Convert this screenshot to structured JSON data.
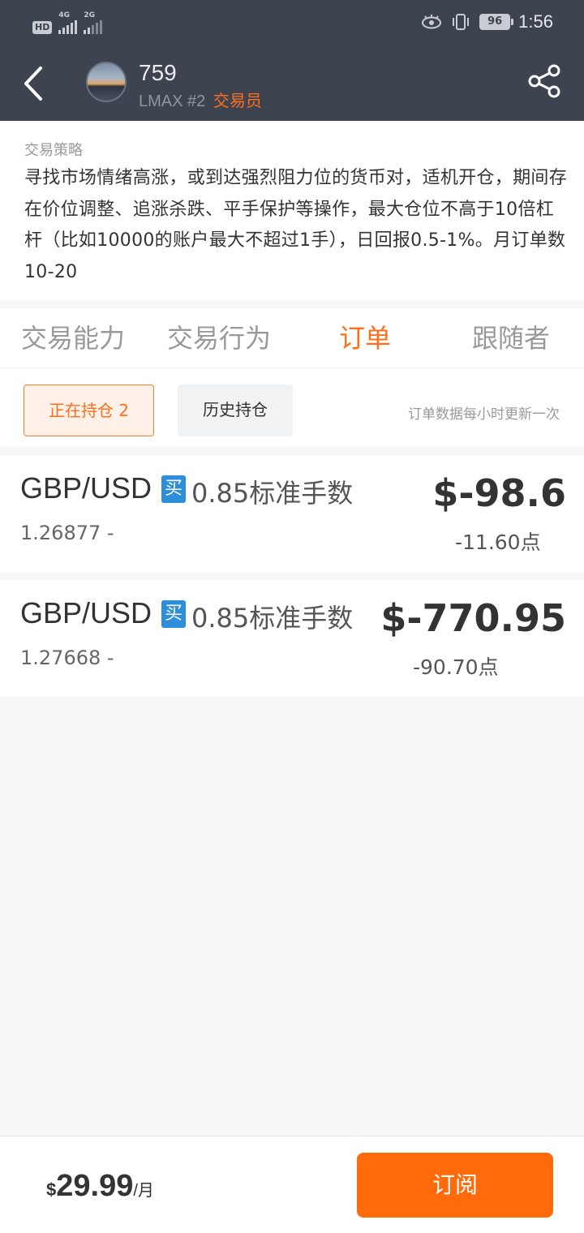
{
  "status_bar": {
    "hd": "HD",
    "net1": "4G",
    "net2": "2G",
    "battery": "96",
    "time": "1:56"
  },
  "header": {
    "username": "759",
    "broker_rank": "LMAX #2",
    "role": "交易员"
  },
  "strategy": {
    "label": "交易策略",
    "text": "寻找市场情绪高涨，或到达强烈阻力位的货币对，适机开仓，期间存在价位调整、追涨杀跌、平手保护等操作，最大仓位不高于10倍杠杆（比如10000的账户最大不超过1手），日回报0.5-1%。月订单数10-20"
  },
  "tabs": [
    {
      "label": "交易能力"
    },
    {
      "label": "交易行为"
    },
    {
      "label": "订单"
    },
    {
      "label": "跟随者"
    }
  ],
  "subtabs": {
    "current": "正在持仓 2",
    "history": "历史持仓",
    "note": "订单数据每小时更新一次"
  },
  "positions": [
    {
      "pair": "GBP/USD",
      "direction": "买",
      "lots": "0.85标准手数",
      "open_price": "1.26877 -",
      "pl": "$-98.6",
      "points": "-11.60点"
    },
    {
      "pair": "GBP/USD",
      "direction": "买",
      "lots": "0.85标准手数",
      "open_price": "1.27668 -",
      "pl": "$-770.95",
      "points": "-90.70点"
    }
  ],
  "footer": {
    "currency": "$",
    "price": "29.99",
    "period": "/月",
    "subscribe_label": "订阅"
  },
  "colors": {
    "accent": "#ff6e1a",
    "header_bg": "#3d4450",
    "buy_badge": "#2e8fd8"
  }
}
